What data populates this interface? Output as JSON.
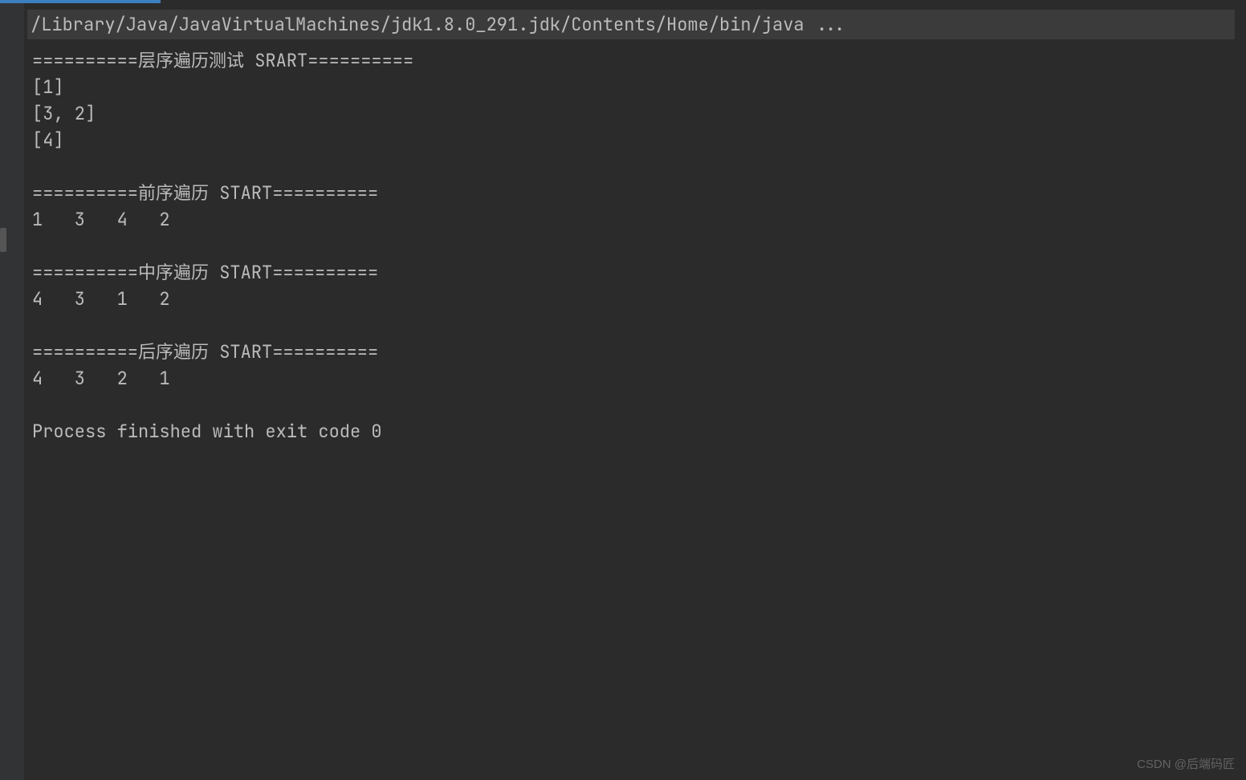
{
  "console": {
    "command": "/Library/Java/JavaVirtualMachines/jdk1.8.0_291.jdk/Contents/Home/bin/java ...",
    "section1": {
      "header": "==========层序遍历测试 SRART==========",
      "line1": "[1]",
      "line2": "[3, 2]",
      "line3": "[4]"
    },
    "section2": {
      "header": "==========前序遍历 START==========",
      "line1": "1   3   4   2   "
    },
    "section3": {
      "header": "==========中序遍历 START==========",
      "line1": "4   3   1   2   "
    },
    "section4": {
      "header": "==========后序遍历 START==========",
      "line1": "4   3   2   1   "
    },
    "exit": "Process finished with exit code 0"
  },
  "watermark": "CSDN @后端码匠"
}
